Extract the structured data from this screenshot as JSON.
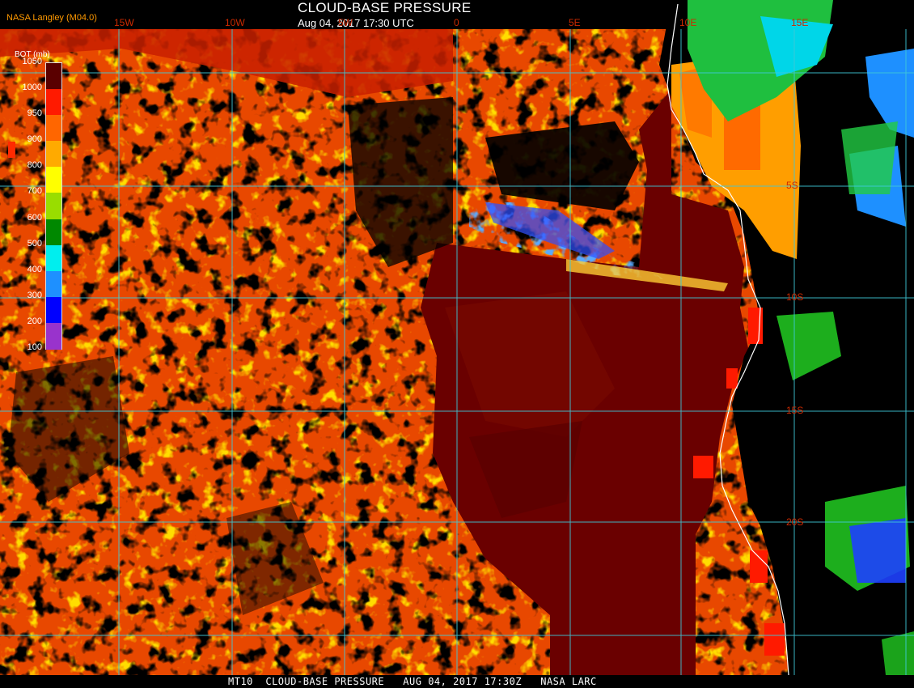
{
  "header": {
    "credit": "NASA Langley (M04.0)",
    "title": "CLOUD-BASE PRESSURE",
    "subtitle": "Aug 04, 2017 17:30 UTC"
  },
  "footer": {
    "text": "MT10  CLOUD-BASE PRESSURE   AUG 04, 2017 17:30Z   NASA LARC"
  },
  "legend": {
    "title": "BOT (mb)",
    "ticks": [
      "1050",
      "1000",
      "950",
      "900",
      "800",
      "700",
      "600",
      "500",
      "400",
      "300",
      "200",
      "100"
    ],
    "colors": [
      "#5a0000",
      "#ff1a00",
      "#ff6600",
      "#ffaa00",
      "#ffff00",
      "#99dd00",
      "#008800",
      "#00eeee",
      "#1e90ff",
      "#0000ff",
      "#9933cc"
    ]
  },
  "grid": {
    "lon_labels": [
      "15W",
      "10W",
      "5W",
      "0",
      "5E",
      "10E",
      "15E"
    ],
    "lat_labels": [
      "5S",
      "10S",
      "15S",
      "20S"
    ],
    "line_color": "#3fc8d8"
  },
  "colors": {
    "land_clear": "#000000",
    "low_stratus": "#6a0000",
    "mid_cloud": "#ff6a00",
    "coastline": "#ffffff"
  }
}
